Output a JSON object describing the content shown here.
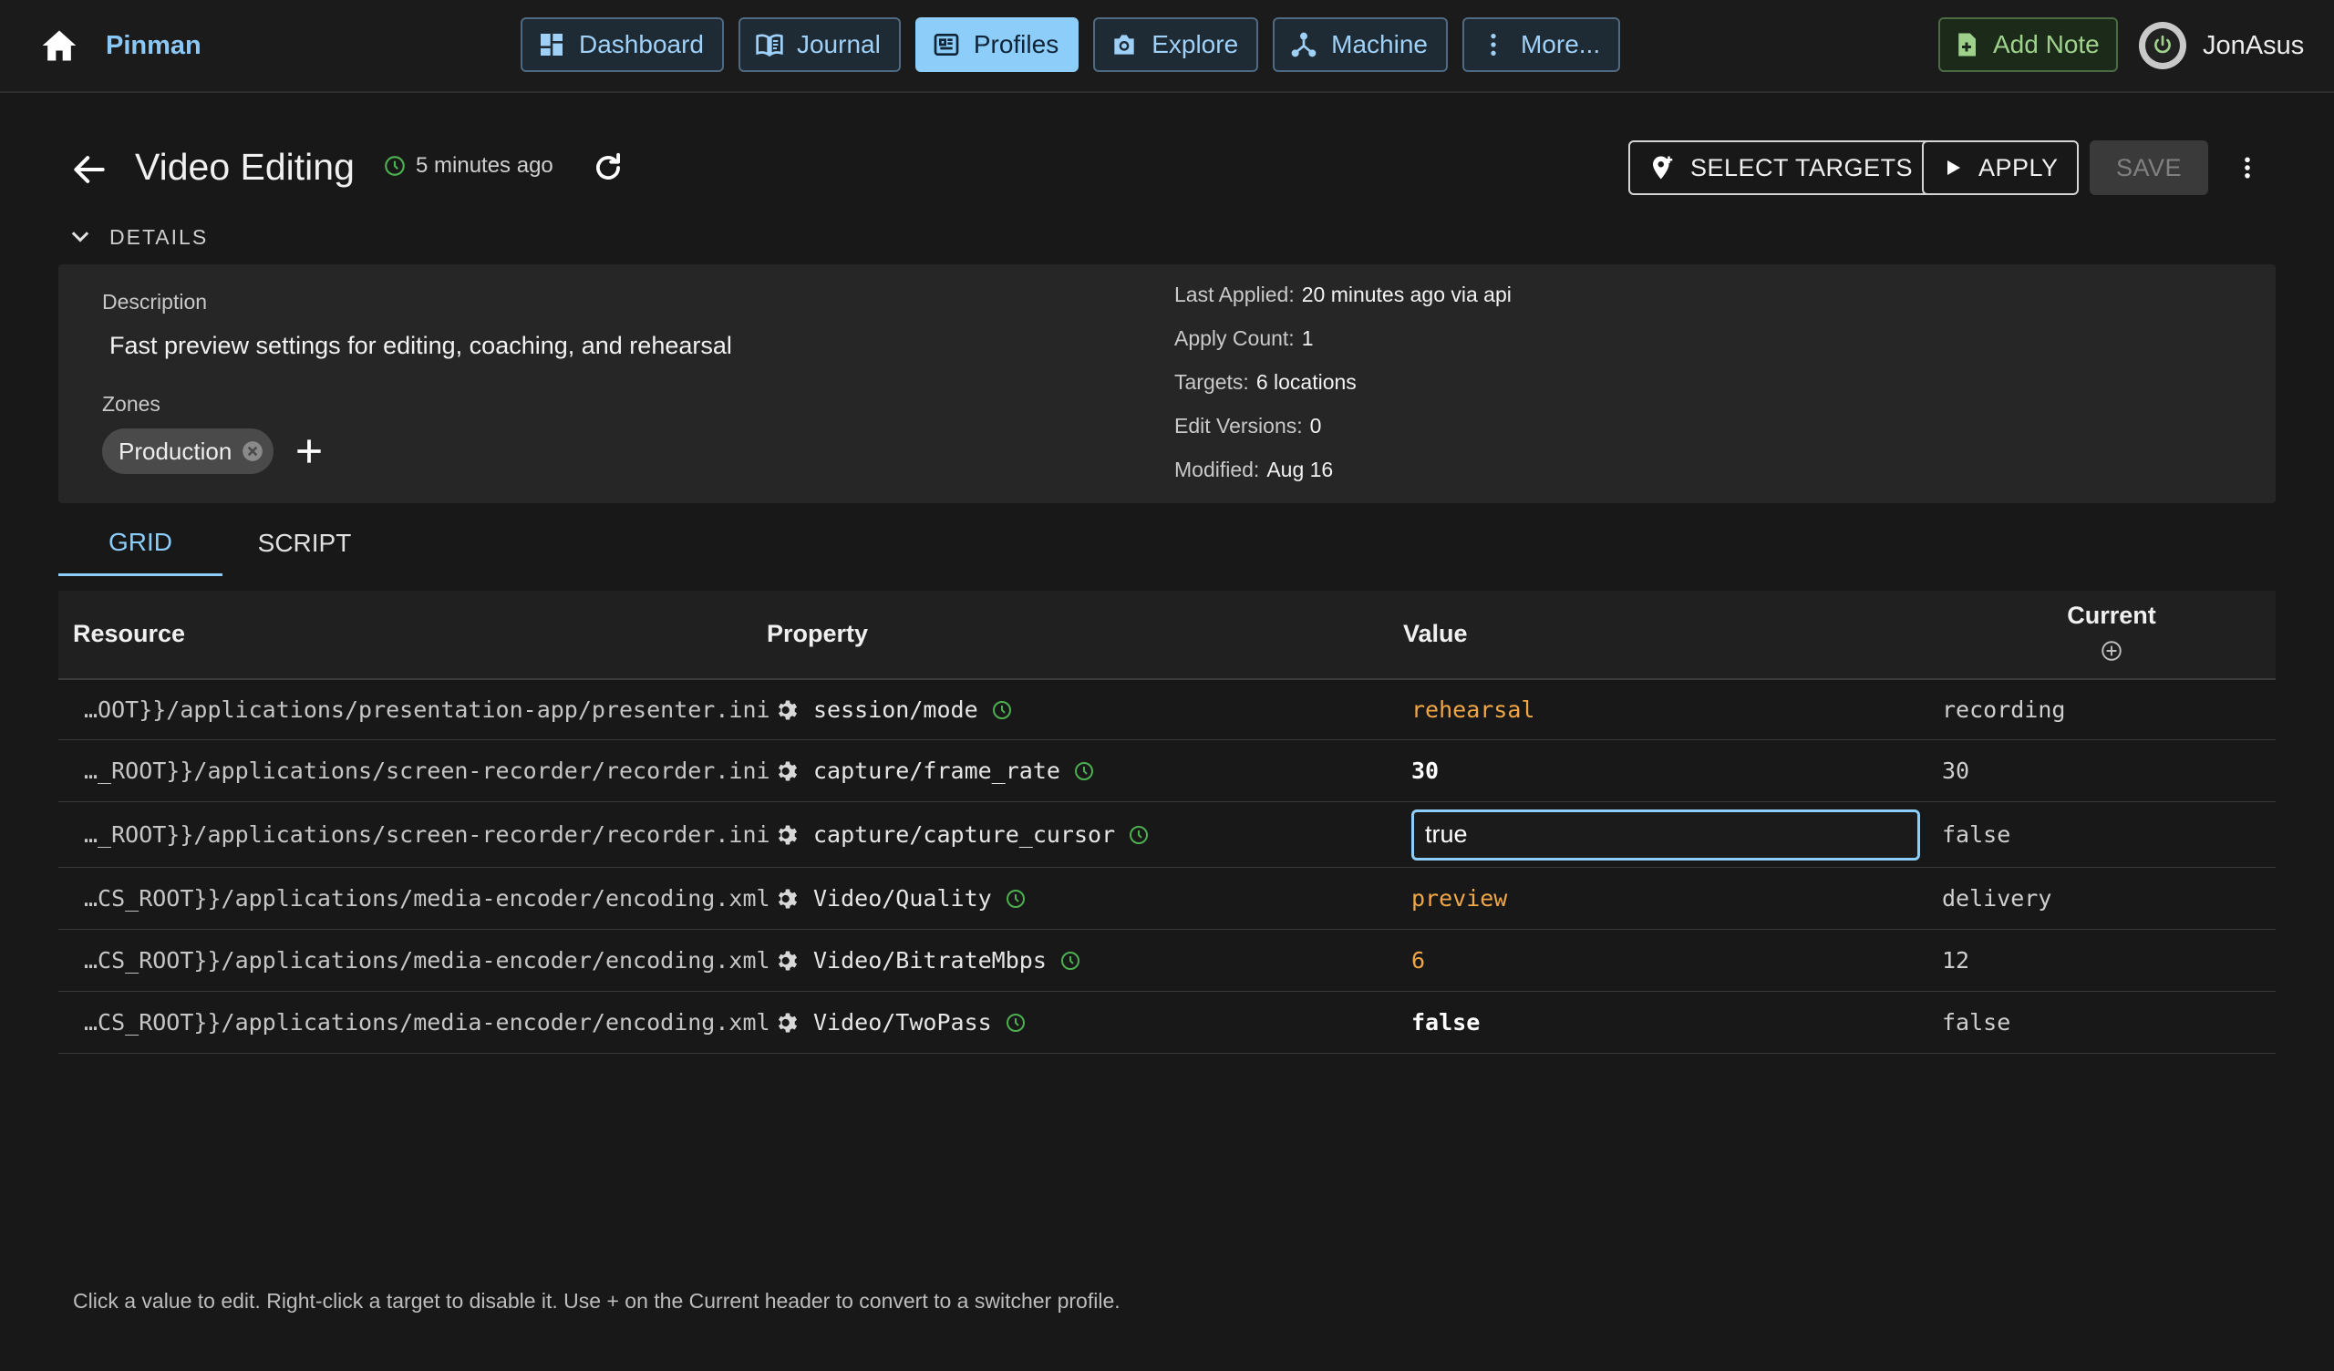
{
  "app": {
    "name": "Pinman",
    "nav": [
      {
        "label": "Dashboard",
        "icon": "dashboard-icon",
        "active": false
      },
      {
        "label": "Journal",
        "icon": "book-icon",
        "active": false
      },
      {
        "label": "Profiles",
        "icon": "profiles-icon",
        "active": true
      },
      {
        "label": "Explore",
        "icon": "camera-icon",
        "active": false
      },
      {
        "label": "Machine",
        "icon": "machine-icon",
        "active": false
      },
      {
        "label": "More...",
        "icon": "more-vertical-icon",
        "active": false
      }
    ],
    "add_note_label": "Add Note",
    "user_name": "JonAsus"
  },
  "profile": {
    "title": "Video Editing",
    "updated": "5 minutes ago",
    "buttons": {
      "select_targets": "SELECT TARGETS",
      "apply": "APPLY",
      "save": "SAVE"
    },
    "details_toggle": "DETAILS",
    "description_label": "Description",
    "description": "Fast preview settings for editing, coaching, and rehearsal",
    "zones_label": "Zones",
    "zones": [
      "Production"
    ],
    "meta": {
      "last_applied_label": "Last Applied:",
      "last_applied": "20 minutes ago via api",
      "apply_count_label": "Apply Count:",
      "apply_count": "1",
      "targets_label": "Targets:",
      "targets": "6 locations",
      "edit_versions_label": "Edit Versions:",
      "edit_versions": "0",
      "modified_label": "Modified:",
      "modified": "Aug 16"
    }
  },
  "tabs": {
    "grid": "GRID",
    "script": "SCRIPT"
  },
  "grid": {
    "headers": {
      "resource": "Resource",
      "property": "Property",
      "value": "Value",
      "current": "Current"
    },
    "rows": [
      {
        "resource": "…OOT}}/applications/presentation-app/presenter.ini",
        "property": "session/mode",
        "value": "rehearsal",
        "current": "recording"
      },
      {
        "resource": "…_ROOT}}/applications/screen-recorder/recorder.ini",
        "property": "capture/frame_rate",
        "value": "30",
        "current": "30"
      },
      {
        "resource": "…_ROOT}}/applications/screen-recorder/recorder.ini",
        "property": "capture/capture_cursor",
        "value": "true",
        "current": "false"
      },
      {
        "resource": "…CS_ROOT}}/applications/media-encoder/encoding.xml",
        "property": "Video/Quality",
        "value": "preview",
        "current": "delivery"
      },
      {
        "resource": "…CS_ROOT}}/applications/media-encoder/encoding.xml",
        "property": "Video/BitrateMbps",
        "value": "6",
        "current": "12"
      },
      {
        "resource": "…CS_ROOT}}/applications/media-encoder/encoding.xml",
        "property": "Video/TwoPass",
        "value": "false",
        "current": "false"
      }
    ]
  },
  "hint": "Click a value to edit. Right-click a target to disable it. Use + on the Current header to convert to a switcher profile.",
  "colors": {
    "accent": "#8ccdfa",
    "changed_value": "#f0a646",
    "clock_green": "#4caf50",
    "add_note_green": "#9fd18c"
  }
}
